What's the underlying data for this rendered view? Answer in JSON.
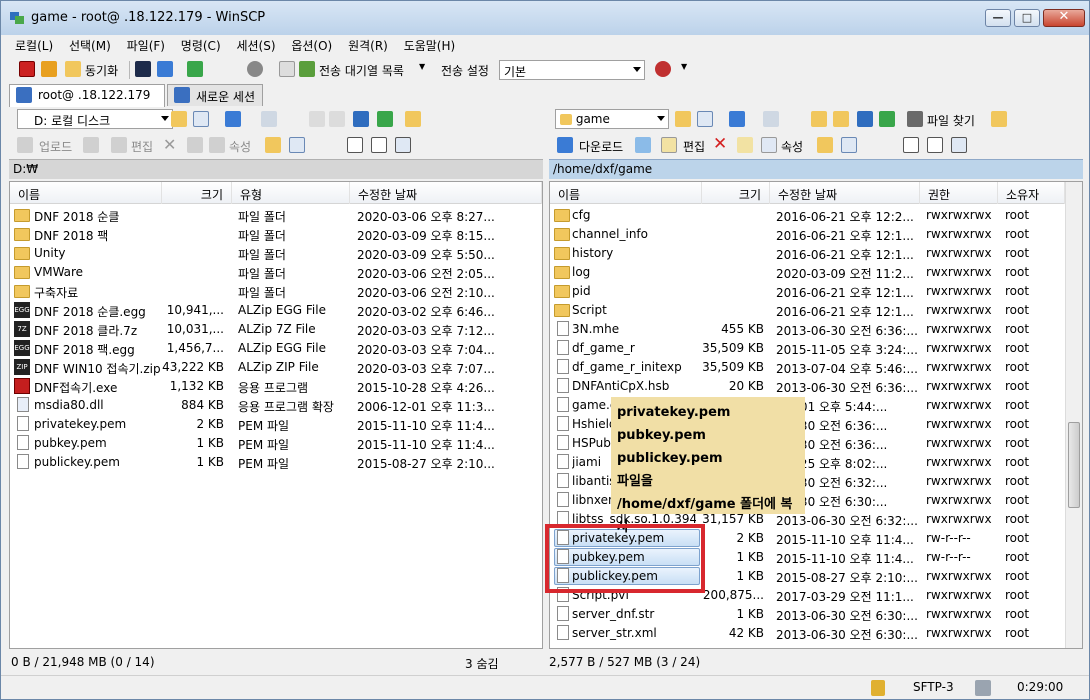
{
  "window": {
    "title": "game - root@        .18.122.179 - WinSCP"
  },
  "menu": [
    "로컬(L)",
    "선택(M)",
    "파일(F)",
    "명령(C)",
    "세션(S)",
    "옵션(O)",
    "원격(R)",
    "도움말(H)"
  ],
  "toolbar": {
    "sync_label": "동기화",
    "queue_label": "전송 대기열 목록",
    "transfer_settings_label": "전송 설정",
    "transfer_settings_value": "기본"
  },
  "tabs": [
    {
      "label": "root@        .18.122.179"
    },
    {
      "label": "새로운 세션"
    }
  ],
  "left": {
    "drive": "D: 로컬 디스크",
    "actions": {
      "upload": "업로드",
      "edit": "편집",
      "properties": "속성"
    },
    "path": "D:₩",
    "columns": [
      "이름",
      "크기",
      "유형",
      "수정한 날짜"
    ],
    "files": [
      {
        "name": "DNF 2018 순클",
        "size": "",
        "type": "파일 폴더",
        "date": "2020-03-06  오후 8:27...",
        "icon": "folder"
      },
      {
        "name": "DNF 2018 팩",
        "size": "",
        "type": "파일 폴더",
        "date": "2020-03-09  오후 8:15...",
        "icon": "folder"
      },
      {
        "name": "Unity",
        "size": "",
        "type": "파일 폴더",
        "date": "2020-03-09  오후 5:50...",
        "icon": "folder"
      },
      {
        "name": "VMWare",
        "size": "",
        "type": "파일 폴더",
        "date": "2020-03-06  오전 2:05...",
        "icon": "folder"
      },
      {
        "name": "구축자료",
        "size": "",
        "type": "파일 폴더",
        "date": "2020-03-06  오전 2:10...",
        "icon": "folder"
      },
      {
        "name": "DNF 2018 순클.egg",
        "size": "10,941,...",
        "type": "ALZip EGG File",
        "date": "2020-03-02  오후 6:46...",
        "icon": "egg"
      },
      {
        "name": "DNF 2018 클라.7z",
        "size": "10,031,...",
        "type": "ALZip 7Z File",
        "date": "2020-03-03  오후 7:12...",
        "icon": "7z"
      },
      {
        "name": "DNF 2018 팩.egg",
        "size": "1,456,7...",
        "type": "ALZip EGG File",
        "date": "2020-03-03  오후 7:04...",
        "icon": "egg"
      },
      {
        "name": "DNF WIN10 접속기.zip",
        "size": "43,222 KB",
        "type": "ALZip ZIP File",
        "date": "2020-03-03  오후 7:07...",
        "icon": "zip"
      },
      {
        "name": "DNF접속기.exe",
        "size": "1,132 KB",
        "type": "응용 프로그램",
        "date": "2015-10-28  오후 4:26...",
        "icon": "app"
      },
      {
        "name": "msdia80.dll",
        "size": "884 KB",
        "type": "응용 프로그램 확장",
        "date": "2006-12-01  오후 11:3...",
        "icon": "dll"
      },
      {
        "name": "privatekey.pem",
        "size": "2 KB",
        "type": "PEM 파일",
        "date": "2015-11-10  오후 11:4...",
        "icon": "file"
      },
      {
        "name": "pubkey.pem",
        "size": "1 KB",
        "type": "PEM 파일",
        "date": "2015-11-10  오후 11:4...",
        "icon": "file"
      },
      {
        "name": "publickey.pem",
        "size": "1 KB",
        "type": "PEM 파일",
        "date": "2015-08-27  오후 2:10...",
        "icon": "file"
      }
    ]
  },
  "right": {
    "dir": "game",
    "find_label": "파일 찾기",
    "actions": {
      "download": "다운로드",
      "edit": "편집",
      "properties": "속성"
    },
    "path": "/home/dxf/game",
    "columns": [
      "이름",
      "크기",
      "수정한 날짜",
      "권한",
      "소유자"
    ],
    "files": [
      {
        "name": "cfg",
        "size": "",
        "date": "2016-06-21 오후 12:2...",
        "perm": "rwxrwxrwx",
        "owner": "root",
        "icon": "folder",
        "sel": false
      },
      {
        "name": "channel_info",
        "size": "",
        "date": "2016-06-21 오후 12:1...",
        "perm": "rwxrwxrwx",
        "owner": "root",
        "icon": "folder",
        "sel": false
      },
      {
        "name": "history",
        "size": "",
        "date": "2016-06-21 오후 12:1...",
        "perm": "rwxrwxrwx",
        "owner": "root",
        "icon": "folder",
        "sel": false
      },
      {
        "name": "log",
        "size": "",
        "date": "2020-03-09 오전 11:2...",
        "perm": "rwxrwxrwx",
        "owner": "root",
        "icon": "folder",
        "sel": false
      },
      {
        "name": "pid",
        "size": "",
        "date": "2016-06-21 오후 12:1...",
        "perm": "rwxrwxrwx",
        "owner": "root",
        "icon": "folder",
        "sel": false
      },
      {
        "name": "Script",
        "size": "",
        "date": "2016-06-21 오후 12:1...",
        "perm": "rwxrwxrwx",
        "owner": "root",
        "icon": "folder",
        "sel": false
      },
      {
        "name": "3N.mhe",
        "size": "455 KB",
        "date": "2013-06-30 오전 6:36:...",
        "perm": "rwxrwxrwx",
        "owner": "root",
        "icon": "file",
        "sel": false
      },
      {
        "name": "df_game_r",
        "size": "35,509 KB",
        "date": "2015-11-05 오후 3:24:...",
        "perm": "rwxrwxrwx",
        "owner": "root",
        "icon": "file",
        "sel": false
      },
      {
        "name": "df_game_r_initexp",
        "size": "35,509 KB",
        "date": "2013-07-04 오후 5:46:...",
        "perm": "rwxrwxrwx",
        "owner": "root",
        "icon": "file",
        "sel": false
      },
      {
        "name": "DNFAntiCpX.hsb",
        "size": "20 KB",
        "date": "2013-06-30 오전 6:36:...",
        "perm": "rwxrwxrwx",
        "owner": "root",
        "icon": "file",
        "sel": false
      },
      {
        "name": "game.c",
        "size": "",
        "date": "-07-01 오후 5:44:...",
        "perm": "rwxrwxrwx",
        "owner": "root",
        "icon": "file",
        "sel": false
      },
      {
        "name": "Hshield.",
        "size": "",
        "date": "-06-30 오전 6:36:...",
        "perm": "rwxrwxrwx",
        "owner": "root",
        "icon": "file",
        "sel": false
      },
      {
        "name": "HSPub.k",
        "size": "",
        "date": "-06-30 오전 6:36:...",
        "perm": "rwxrwxrwx",
        "owner": "root",
        "icon": "file",
        "sel": false
      },
      {
        "name": "jiami",
        "size": "",
        "date": "-06-25 오후 8:02:...",
        "perm": "rwxrwxrwx",
        "owner": "root",
        "icon": "file",
        "sel": false
      },
      {
        "name": "libantisv",
        "size": "",
        "date": "-06-30 오전 6:32:...",
        "perm": "rwxrwxrwx",
        "owner": "root",
        "icon": "file",
        "sel": false
      },
      {
        "name": "libnxenc",
        "size": "",
        "date": "-06-30 오전 6:30:...",
        "perm": "rwxrwxrwx",
        "owner": "root",
        "icon": "file",
        "sel": false
      },
      {
        "name": "libtss_sdk.so.1.0.394",
        "size": "31,157 KB",
        "date": "2013-06-30 오전 6:32:...",
        "perm": "rwxrwxrwx",
        "owner": "root",
        "icon": "file",
        "sel": false
      },
      {
        "name": "privatekey.pem",
        "size": "2 KB",
        "date": "2015-11-10 오후 11:4...",
        "perm": "rw-r--r--",
        "owner": "root",
        "icon": "file",
        "sel": true
      },
      {
        "name": "pubkey.pem",
        "size": "1 KB",
        "date": "2015-11-10 오후 11:4...",
        "perm": "rw-r--r--",
        "owner": "root",
        "icon": "file",
        "sel": true
      },
      {
        "name": "publickey.pem",
        "size": "1 KB",
        "date": "2015-08-27 오후 2:10:...",
        "perm": "rwxrwxrwx",
        "owner": "root",
        "icon": "file",
        "sel": true
      },
      {
        "name": "Script.pvf",
        "size": "200,875...",
        "date": "2017-03-29 오전 11:1...",
        "perm": "rwxrwxrwx",
        "owner": "root",
        "icon": "file",
        "sel": false
      },
      {
        "name": "server_dnf.str",
        "size": "1 KB",
        "date": "2013-06-30 오전 6:30:...",
        "perm": "rwxrwxrwx",
        "owner": "root",
        "icon": "file",
        "sel": false
      },
      {
        "name": "server_str.xml",
        "size": "42 KB",
        "date": "2013-06-30 오전 6:30:...",
        "perm": "rwxrwxrwx",
        "owner": "root",
        "icon": "file",
        "sel": false
      }
    ]
  },
  "tooltip": [
    "privatekey.pem",
    "pubkey.pem",
    "publickey.pem",
    "파일을",
    "/home/dxf/game 폴더에 복사"
  ],
  "status": {
    "left": "0 B / 21,948 MB (0 / 14)",
    "hidden": "3 숨김",
    "right": "2,577 B / 527 MB (3 / 24)",
    "protocol": "SFTP-3",
    "time": "0:29:00"
  },
  "colors": {
    "accent": "#d8282e",
    "tooltip_bg": "#f1dfa6",
    "selection": "#c9dff5",
    "pathbar": "#bcd4ea"
  }
}
